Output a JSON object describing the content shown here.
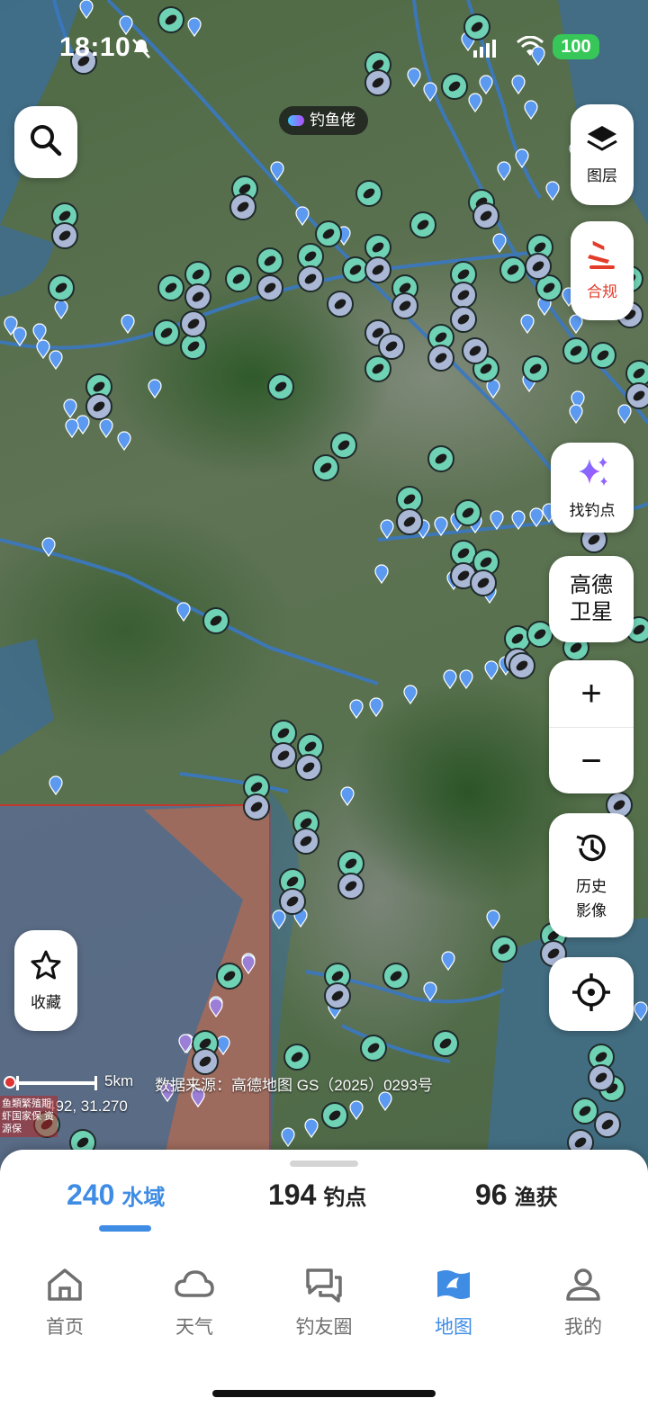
{
  "status": {
    "time": "18:10",
    "battery": "100"
  },
  "brand": {
    "label": "钓鱼佬"
  },
  "controls": {
    "layers_label": "图层",
    "compliance_label": "合规",
    "find_spot_label": "找钓点",
    "satellite_label": "高德\n卫星",
    "satellite_line1": "高德",
    "satellite_line2": "卫星",
    "zoom_in": "+",
    "zoom_out": "−",
    "history_line1": "历史",
    "history_line2": "影像",
    "favorites_label": "收藏"
  },
  "map_info": {
    "scale": "5km",
    "source": "数据来源：高德地图 GS（2025）0293号",
    "coordinates": "492, 31.270",
    "legal_text": "鱼類繁殖期 虾国家保 资源保"
  },
  "stats": [
    {
      "value": "240",
      "unit": "水域",
      "active": true
    },
    {
      "value": "194",
      "unit": "钓点",
      "active": false
    },
    {
      "value": "96",
      "unit": "渔获",
      "active": false
    }
  ],
  "nav": [
    {
      "label": "首页",
      "icon": "home-icon"
    },
    {
      "label": "天气",
      "icon": "cloud-icon"
    },
    {
      "label": "钓友圈",
      "icon": "chat-icon"
    },
    {
      "label": "地图",
      "icon": "map-icon",
      "active": true
    },
    {
      "label": "我的",
      "icon": "profile-icon"
    }
  ],
  "colors": {
    "accent": "#3f8ce4",
    "compliance": "#e33c2b",
    "water": "#3d6d93",
    "pin_spot": "#6fd2b4",
    "pin_catch": "#aab8d6",
    "pin_small": "#5b9af0"
  }
}
